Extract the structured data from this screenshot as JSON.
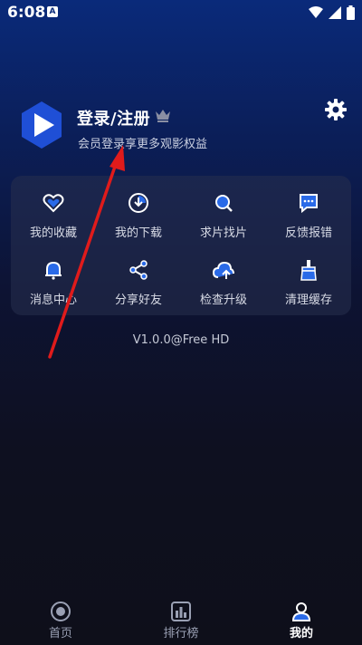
{
  "status_bar": {
    "time": "6:08",
    "notification_badge": "A",
    "icons": [
      "wifi-icon",
      "signal-icon",
      "battery-icon"
    ]
  },
  "profile": {
    "login_title": "登录/注册",
    "subtitle": "会员登录享更多观影权益",
    "logo_icon": "play-logo-icon",
    "crown_icon": "crown-icon",
    "settings_icon": "gear-icon"
  },
  "grid": {
    "items": [
      {
        "label": "我的收藏",
        "icon": "heart-icon"
      },
      {
        "label": "我的下载",
        "icon": "download-icon"
      },
      {
        "label": "求片找片",
        "icon": "search-film-icon"
      },
      {
        "label": "反馈报错",
        "icon": "feedback-icon"
      },
      {
        "label": "消息中心",
        "icon": "bell-icon"
      },
      {
        "label": "分享好友",
        "icon": "share-icon"
      },
      {
        "label": "检查升级",
        "icon": "upgrade-icon"
      },
      {
        "label": "清理缓存",
        "icon": "clean-icon"
      }
    ]
  },
  "version": "V1.0.0@Free HD",
  "bottom_nav": {
    "items": [
      {
        "label": "首页",
        "icon": "home-icon",
        "active": false
      },
      {
        "label": "排行榜",
        "icon": "ranking-icon",
        "active": false
      },
      {
        "label": "我的",
        "icon": "profile-icon",
        "active": true
      }
    ]
  },
  "colors": {
    "accent": "#2a6ae8",
    "annotation_arrow": "#e01b1b",
    "background_top": "#0a2a7a",
    "background_bottom": "#0e0f1a"
  }
}
